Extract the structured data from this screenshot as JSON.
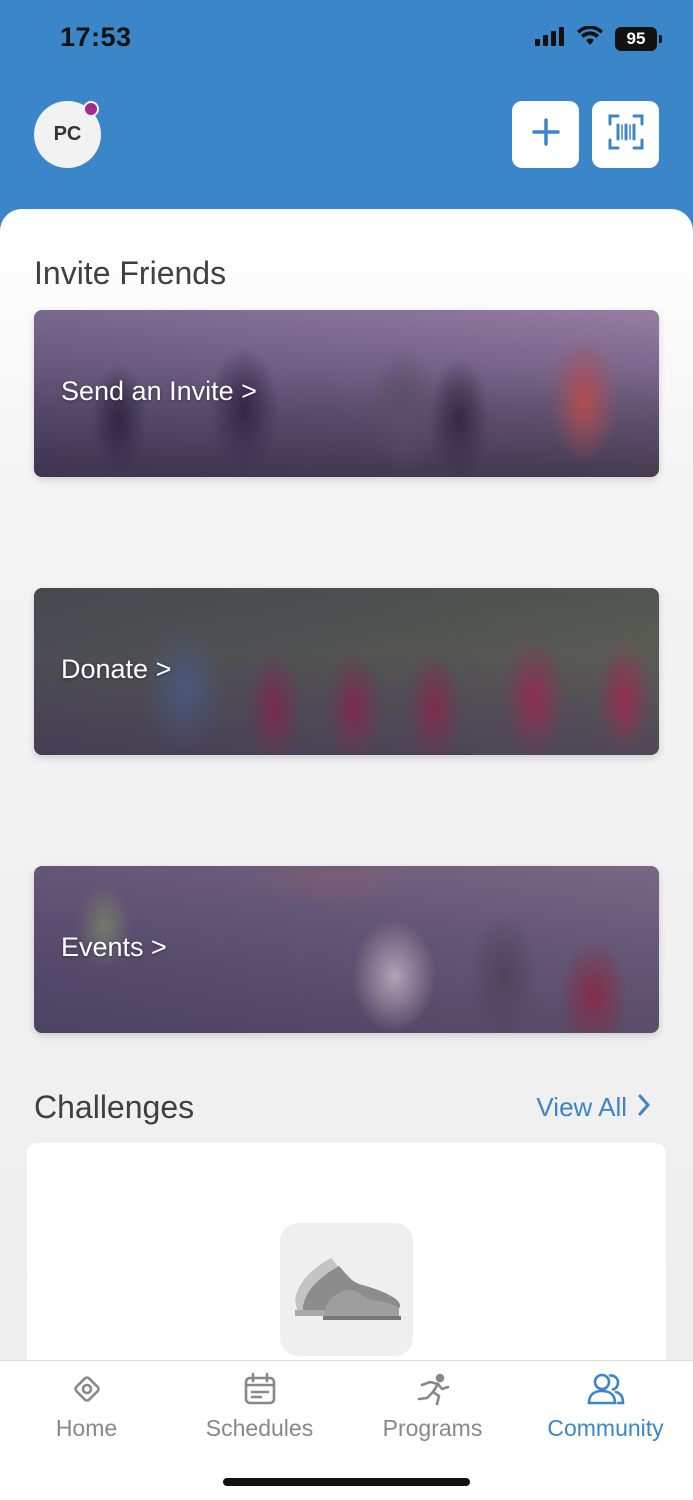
{
  "status_bar": {
    "time": "17:53",
    "battery": "95",
    "icons": [
      "signal-icon",
      "wifi-icon",
      "battery-icon"
    ]
  },
  "header": {
    "avatar_initials": "PC",
    "avatar_badge_color": "#a42a8a",
    "actions": [
      {
        "name": "add-button",
        "icon": "plus-icon"
      },
      {
        "name": "scan-button",
        "icon": "barcode-scan-icon"
      }
    ]
  },
  "invite_section": {
    "title": "Invite Friends",
    "cards": [
      {
        "label": "Send an Invite >"
      },
      {
        "label": "Donate >"
      },
      {
        "label": "Events >"
      }
    ]
  },
  "challenges_section": {
    "title": "Challenges",
    "view_all": "View All",
    "card_icon": "sneaker-icon"
  },
  "tabbar": {
    "tabs": [
      {
        "label": "Home",
        "icon": "home-icon"
      },
      {
        "label": "Schedules",
        "icon": "calendar-icon"
      },
      {
        "label": "Programs",
        "icon": "runner-icon"
      },
      {
        "label": "Community",
        "icon": "people-icon",
        "active": true
      }
    ]
  },
  "colors": {
    "brand": "#3b86c8",
    "accent_badge": "#a42a8a"
  }
}
